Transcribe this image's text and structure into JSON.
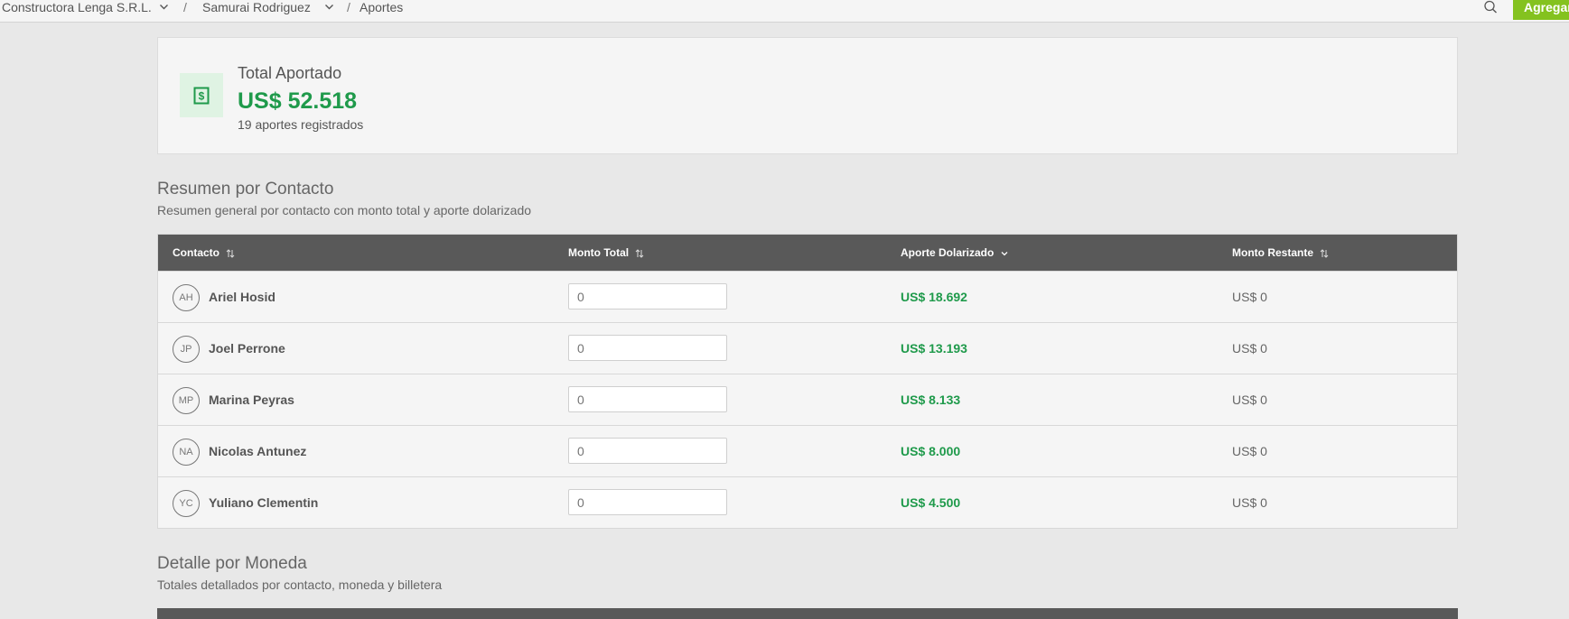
{
  "breadcrumb": {
    "company": "Constructora Lenga S.R.L.",
    "person": "Samurai Rodriguez",
    "page": "Aportes",
    "separator": "/"
  },
  "header": {
    "add_label": "Agregar"
  },
  "summary": {
    "label": "Total Aportado",
    "value": "US$ 52.518",
    "count": "19 aportes registrados"
  },
  "contact_section": {
    "title": "Resumen por Contacto",
    "subtitle": "Resumen general por contacto con monto total y aporte dolarizado",
    "columns": {
      "contact": "Contacto",
      "monto_total": "Monto Total",
      "aporte_dolarizado": "Aporte Dolarizado",
      "monto_restante": "Monto Restante"
    },
    "rows": [
      {
        "initials": "AH",
        "name": "Ariel Hosid",
        "monto_total": "0",
        "aporte": "US$ 18.692",
        "restante": "US$ 0"
      },
      {
        "initials": "JP",
        "name": "Joel Perrone",
        "monto_total": "0",
        "aporte": "US$ 13.193",
        "restante": "US$ 0"
      },
      {
        "initials": "MP",
        "name": "Marina Peyras",
        "monto_total": "0",
        "aporte": "US$ 8.133",
        "restante": "US$ 0"
      },
      {
        "initials": "NA",
        "name": "Nicolas Antunez",
        "monto_total": "0",
        "aporte": "US$ 8.000",
        "restante": "US$ 0"
      },
      {
        "initials": "YC",
        "name": "Yuliano Clementin",
        "monto_total": "0",
        "aporte": "US$ 4.500",
        "restante": "US$ 0"
      }
    ]
  },
  "currency_section": {
    "title": "Detalle por Moneda",
    "subtitle": "Totales detallados por contacto, moneda y billetera"
  },
  "colors": {
    "accent_green": "#1f9a4b",
    "button_green": "#84c21f",
    "table_header": "#595959"
  }
}
